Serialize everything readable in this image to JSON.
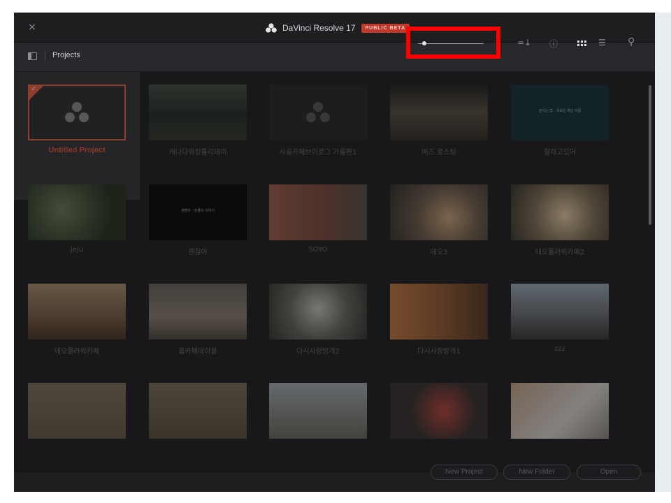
{
  "titlebar": {
    "close_glyph": "×",
    "app_title": "DaVinci Resolve 17",
    "badge": "PUBLIC BETA"
  },
  "toolbar": {
    "section_label": "Projects",
    "icons": [
      "sidebar-toggle-icon",
      "sort-icon",
      "info-icon",
      "grid-view-icon",
      "list-view-icon",
      "search-icon"
    ],
    "sort_glyph": "=↓",
    "info_glyph": "ⓘ",
    "list_glyph": "☰",
    "search_glyph": "⚲"
  },
  "projects": [
    {
      "name": "Untitled Project",
      "selected": true
    },
    {
      "name": "캐나다워킹홀리데이"
    },
    {
      "name": "시골카페브이로그 가을편1"
    },
    {
      "name": "버즈 로스팅"
    },
    {
      "name": "잘하고있어"
    },
    {
      "name": "jeju"
    },
    {
      "name": "괜찮아"
    },
    {
      "name": "SOYO"
    },
    {
      "name": "데오3"
    },
    {
      "name": "데오플라워카페2"
    },
    {
      "name": "데오플라워카페"
    },
    {
      "name": "홈카페데이블"
    },
    {
      "name": "다시사랑방개2"
    },
    {
      "name": "다시사랑방개1"
    },
    {
      "name": "zzz"
    },
    {
      "name": ""
    },
    {
      "name": ""
    },
    {
      "name": ""
    },
    {
      "name": ""
    },
    {
      "name": ""
    }
  ],
  "thumb_texts": {
    "t5": "잘사는 법 : 새로운 채널 이름",
    "t7": "괜찮아 : 한줄의 이야기"
  },
  "footer": {
    "new_project": "New Project",
    "new_folder": "New Folder",
    "open": "Open"
  },
  "colors": {
    "accent": "#e5644a",
    "highlight": "#ff0000",
    "badge": "#c0392b"
  }
}
